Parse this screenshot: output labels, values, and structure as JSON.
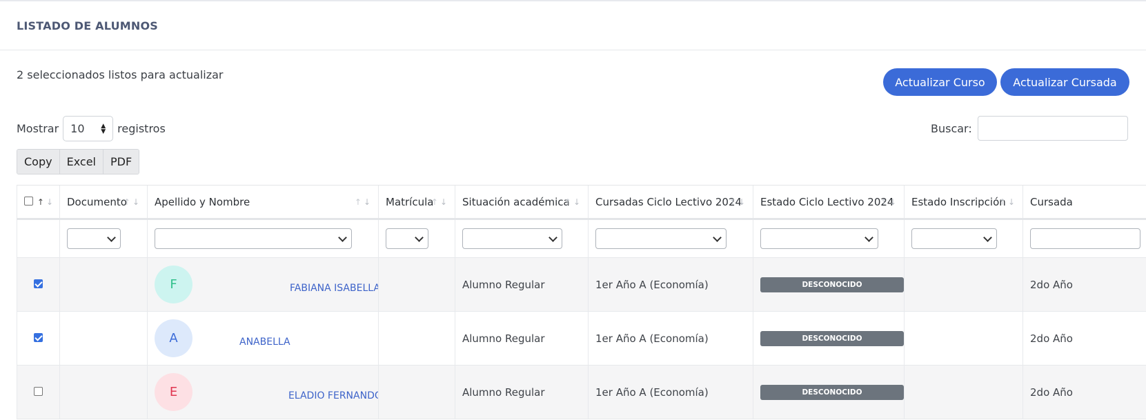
{
  "card": {
    "title": "LISTADO DE ALUMNOS"
  },
  "selection_info": "2 seleccionados listos para actualizar",
  "buttons": {
    "update_course": "Actualizar Curso",
    "update_cursada": "Actualizar Cursada"
  },
  "length_menu": {
    "prefix": "Mostrar",
    "value": "10",
    "suffix": "registros"
  },
  "search": {
    "label": "Buscar:",
    "value": ""
  },
  "export_buttons": [
    "Copy",
    "Excel",
    "PDF"
  ],
  "table": {
    "columns": [
      "Documento",
      "Apellido y Nombre",
      "Matrícula",
      "Situación académica",
      "Cursadas Ciclo Lectivo 2024",
      "Estado Ciclo Lectivo 2024",
      "Estado Inscripción",
      "Cursada"
    ],
    "rows": [
      {
        "checked": true,
        "documento": "",
        "initial": "F",
        "name": "FABIANA ISABELLA",
        "matricula": "",
        "situacion": "Alumno Regular",
        "cursadas": "1er Año A (Economía)",
        "estado_ciclo": "DESCONOCIDO",
        "estado_inscripcion": "",
        "cursada": "2do Año"
      },
      {
        "checked": true,
        "documento": "",
        "initial": "A",
        "name": "ANABELLA",
        "matricula": "",
        "situacion": "Alumno Regular",
        "cursadas": "1er Año A (Economía)",
        "estado_ciclo": "DESCONOCIDO",
        "estado_inscripcion": "",
        "cursada": "2do Año"
      },
      {
        "checked": false,
        "documento": "",
        "initial": "E",
        "name": "ELADIO FERNANDO",
        "matricula": "",
        "situacion": "Alumno Regular",
        "cursadas": "1er Año A (Economía)",
        "estado_ciclo": "DESCONOCIDO",
        "estado_inscripcion": "",
        "cursada": "2do Año"
      }
    ]
  },
  "colors": {
    "primary": "#3b6bd8",
    "badge_gray": "#6c747d",
    "link_blue": "#3d63c9",
    "avatar_f_bg": "#cdf4f0",
    "avatar_f_fg": "#2fbf8a",
    "avatar_a_bg": "#dde9fb",
    "avatar_a_fg": "#3b6bd8",
    "avatar_e_bg": "#fde0e4",
    "avatar_e_fg": "#e0354f"
  }
}
